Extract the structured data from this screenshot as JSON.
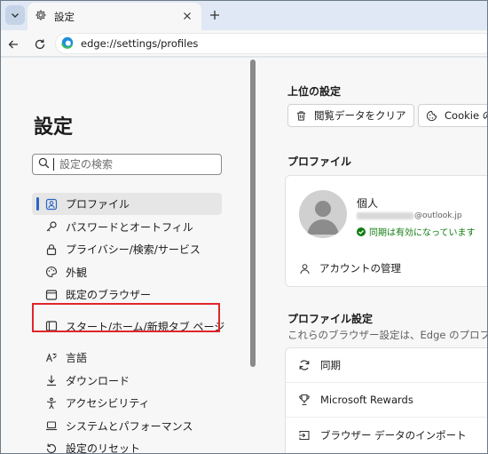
{
  "browser": {
    "tab_title": "設定",
    "url": "edge://settings/profiles",
    "icons": [
      "tab-actions-menu-icon",
      "gear-icon",
      "close-icon",
      "plus-icon",
      "back-arrow-icon",
      "reload-icon",
      "edge-logo-icon"
    ]
  },
  "sidebar": {
    "title": "設定",
    "search_placeholder": "設定の検索",
    "items": [
      {
        "label": "プロファイル",
        "icon": "profile-icon",
        "active": true
      },
      {
        "label": "パスワードとオートフィル",
        "icon": "key-icon"
      },
      {
        "label": "プライバシー/検索/サービス",
        "icon": "lock-icon"
      },
      {
        "label": "外観",
        "icon": "palette-icon"
      },
      {
        "label": "既定のブラウザー",
        "icon": "browser-window-icon"
      },
      {
        "label": "スタート/ホーム/新規タブ ページ",
        "icon": "home-window-icon",
        "highlighted": true
      },
      {
        "label": "言語",
        "icon": "language-icon"
      },
      {
        "label": "ダウンロード",
        "icon": "download-icon"
      },
      {
        "label": "アクセシビリティ",
        "icon": "accessibility-icon"
      },
      {
        "label": "システムとパフォーマンス",
        "icon": "laptop-icon"
      },
      {
        "label": "設定のリセット",
        "icon": "reset-icon"
      }
    ]
  },
  "content": {
    "top_settings_title": "上位の設定",
    "top_buttons": {
      "clear_data": "閲覧データをクリア",
      "cookie": "Cookie の"
    },
    "profile_section_title": "プロファイル",
    "profile": {
      "name": "個人",
      "email_domain": "@outlook.jp",
      "sync_status": "同期は有効になっています",
      "manage_account": "アカウントの管理"
    },
    "profile_settings_title": "プロファイル設定",
    "profile_settings_desc": "これらのブラウザー設定は、Edge のプロファ",
    "settings_rows": [
      {
        "label": "同期",
        "icon": "sync-icon"
      },
      {
        "label": "Microsoft Rewards",
        "icon": "rewards-trophy-icon"
      },
      {
        "label": "ブラウザー データのインポート",
        "icon": "import-icon"
      }
    ]
  },
  "colors": {
    "accent": "#2b64c5",
    "highlight": "#e0262b",
    "sync_green": "#107c10"
  }
}
